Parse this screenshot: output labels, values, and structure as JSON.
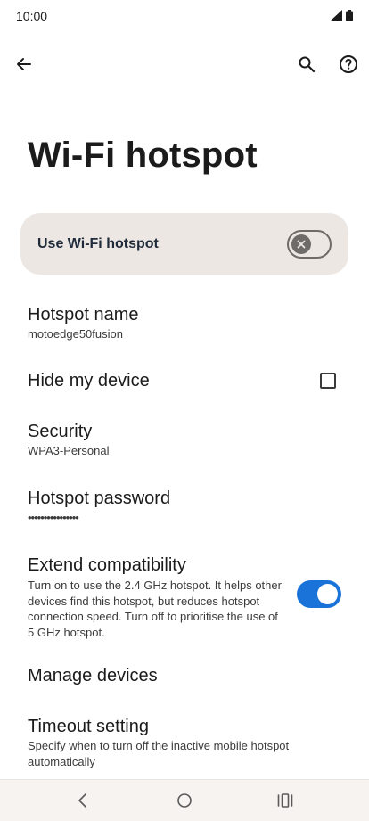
{
  "status_bar": {
    "time": "10:00",
    "icons": [
      "signal-icon",
      "battery-icon"
    ]
  },
  "app_bar": {
    "icons": [
      "back-arrow-icon",
      "search-icon",
      "help-icon"
    ]
  },
  "page": {
    "title": "Wi-Fi hotspot"
  },
  "main_switch": {
    "label": "Use Wi-Fi hotspot",
    "state": "off"
  },
  "settings": {
    "hotspot_name": {
      "title": "Hotspot name",
      "value": "motoedge50fusion"
    },
    "hide_device": {
      "title": "Hide my device",
      "checked": false
    },
    "security": {
      "title": "Security",
      "value": "WPA3-Personal"
    },
    "hotspot_password": {
      "title": "Hotspot password",
      "masked": "••••••••••••••••"
    },
    "extend_compat": {
      "title": "Extend compatibility",
      "description": "Turn on to use the 2.4 GHz hotspot. It helps other devices find this hotspot, but reduces hotspot connection speed. Turn off to prioritise the use of 5 GHz hotspot.",
      "state": "on"
    },
    "manage_devices": {
      "title": "Manage devices"
    },
    "timeout": {
      "title": "Timeout setting",
      "description": "Specify when to turn off the inactive mobile hotspot automatically"
    }
  },
  "nav_bar": {
    "icons": [
      "nav-back-icon",
      "nav-home-icon",
      "nav-recents-icon"
    ]
  },
  "colors": {
    "accent": "#1a73d9",
    "card": "#ece7e3",
    "text": "#1b1b1b"
  }
}
